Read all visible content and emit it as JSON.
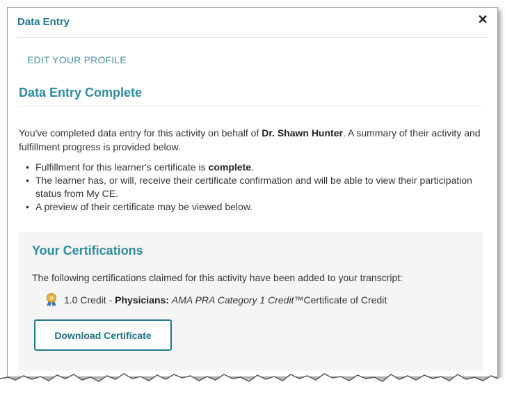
{
  "modal": {
    "title": "Data Entry",
    "close_icon": "close-icon"
  },
  "profile_link": "EDIT YOUR PROFILE",
  "section": {
    "title": "Data Entry Complete",
    "intro_before": "You've completed data entry for this activity on behalf of ",
    "learner_name": "Dr. Shawn Hunter",
    "intro_after": ". A summary of their activity and fulfillment progress is provided below.",
    "bullets": [
      {
        "before": "Fulfillment for this learner's certificate is ",
        "bold": "complete",
        "after": "."
      },
      {
        "before": "The learner has, or will, receive their certificate confirmation and will be able to view their participation status from My CE.",
        "bold": "",
        "after": ""
      },
      {
        "before": "A preview of their certificate may be viewed below.",
        "bold": "",
        "after": ""
      }
    ]
  },
  "certifications": {
    "title": "Your Certifications",
    "description": "The following certifications claimed for this activity have been added to your transcript:",
    "credit": {
      "icon": "award-ribbon-icon",
      "amount": "1.0 Credit - ",
      "type": "Physicians:",
      "name": "AMA PRA Category 1 Credit™",
      "suffix": " Certificate of Credit"
    },
    "download_label": "Download Certificate"
  },
  "colors": {
    "accent": "#1f7a8c",
    "heading": "#2e8ba0",
    "link": "#4a90a4",
    "panel_bg": "#f5f5f5"
  }
}
